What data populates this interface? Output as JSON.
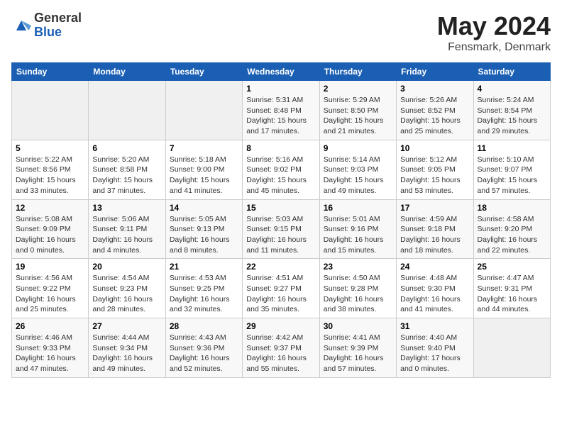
{
  "header": {
    "logo_general": "General",
    "logo_blue": "Blue",
    "month_title": "May 2024",
    "location": "Fensmark, Denmark"
  },
  "days_of_week": [
    "Sunday",
    "Monday",
    "Tuesday",
    "Wednesday",
    "Thursday",
    "Friday",
    "Saturday"
  ],
  "weeks": [
    [
      {
        "day": "",
        "content": ""
      },
      {
        "day": "",
        "content": ""
      },
      {
        "day": "",
        "content": ""
      },
      {
        "day": "1",
        "content": "Sunrise: 5:31 AM\nSunset: 8:48 PM\nDaylight: 15 hours\nand 17 minutes."
      },
      {
        "day": "2",
        "content": "Sunrise: 5:29 AM\nSunset: 8:50 PM\nDaylight: 15 hours\nand 21 minutes."
      },
      {
        "day": "3",
        "content": "Sunrise: 5:26 AM\nSunset: 8:52 PM\nDaylight: 15 hours\nand 25 minutes."
      },
      {
        "day": "4",
        "content": "Sunrise: 5:24 AM\nSunset: 8:54 PM\nDaylight: 15 hours\nand 29 minutes."
      }
    ],
    [
      {
        "day": "5",
        "content": "Sunrise: 5:22 AM\nSunset: 8:56 PM\nDaylight: 15 hours\nand 33 minutes."
      },
      {
        "day": "6",
        "content": "Sunrise: 5:20 AM\nSunset: 8:58 PM\nDaylight: 15 hours\nand 37 minutes."
      },
      {
        "day": "7",
        "content": "Sunrise: 5:18 AM\nSunset: 9:00 PM\nDaylight: 15 hours\nand 41 minutes."
      },
      {
        "day": "8",
        "content": "Sunrise: 5:16 AM\nSunset: 9:02 PM\nDaylight: 15 hours\nand 45 minutes."
      },
      {
        "day": "9",
        "content": "Sunrise: 5:14 AM\nSunset: 9:03 PM\nDaylight: 15 hours\nand 49 minutes."
      },
      {
        "day": "10",
        "content": "Sunrise: 5:12 AM\nSunset: 9:05 PM\nDaylight: 15 hours\nand 53 minutes."
      },
      {
        "day": "11",
        "content": "Sunrise: 5:10 AM\nSunset: 9:07 PM\nDaylight: 15 hours\nand 57 minutes."
      }
    ],
    [
      {
        "day": "12",
        "content": "Sunrise: 5:08 AM\nSunset: 9:09 PM\nDaylight: 16 hours\nand 0 minutes."
      },
      {
        "day": "13",
        "content": "Sunrise: 5:06 AM\nSunset: 9:11 PM\nDaylight: 16 hours\nand 4 minutes."
      },
      {
        "day": "14",
        "content": "Sunrise: 5:05 AM\nSunset: 9:13 PM\nDaylight: 16 hours\nand 8 minutes."
      },
      {
        "day": "15",
        "content": "Sunrise: 5:03 AM\nSunset: 9:15 PM\nDaylight: 16 hours\nand 11 minutes."
      },
      {
        "day": "16",
        "content": "Sunrise: 5:01 AM\nSunset: 9:16 PM\nDaylight: 16 hours\nand 15 minutes."
      },
      {
        "day": "17",
        "content": "Sunrise: 4:59 AM\nSunset: 9:18 PM\nDaylight: 16 hours\nand 18 minutes."
      },
      {
        "day": "18",
        "content": "Sunrise: 4:58 AM\nSunset: 9:20 PM\nDaylight: 16 hours\nand 22 minutes."
      }
    ],
    [
      {
        "day": "19",
        "content": "Sunrise: 4:56 AM\nSunset: 9:22 PM\nDaylight: 16 hours\nand 25 minutes."
      },
      {
        "day": "20",
        "content": "Sunrise: 4:54 AM\nSunset: 9:23 PM\nDaylight: 16 hours\nand 28 minutes."
      },
      {
        "day": "21",
        "content": "Sunrise: 4:53 AM\nSunset: 9:25 PM\nDaylight: 16 hours\nand 32 minutes."
      },
      {
        "day": "22",
        "content": "Sunrise: 4:51 AM\nSunset: 9:27 PM\nDaylight: 16 hours\nand 35 minutes."
      },
      {
        "day": "23",
        "content": "Sunrise: 4:50 AM\nSunset: 9:28 PM\nDaylight: 16 hours\nand 38 minutes."
      },
      {
        "day": "24",
        "content": "Sunrise: 4:48 AM\nSunset: 9:30 PM\nDaylight: 16 hours\nand 41 minutes."
      },
      {
        "day": "25",
        "content": "Sunrise: 4:47 AM\nSunset: 9:31 PM\nDaylight: 16 hours\nand 44 minutes."
      }
    ],
    [
      {
        "day": "26",
        "content": "Sunrise: 4:46 AM\nSunset: 9:33 PM\nDaylight: 16 hours\nand 47 minutes."
      },
      {
        "day": "27",
        "content": "Sunrise: 4:44 AM\nSunset: 9:34 PM\nDaylight: 16 hours\nand 49 minutes."
      },
      {
        "day": "28",
        "content": "Sunrise: 4:43 AM\nSunset: 9:36 PM\nDaylight: 16 hours\nand 52 minutes."
      },
      {
        "day": "29",
        "content": "Sunrise: 4:42 AM\nSunset: 9:37 PM\nDaylight: 16 hours\nand 55 minutes."
      },
      {
        "day": "30",
        "content": "Sunrise: 4:41 AM\nSunset: 9:39 PM\nDaylight: 16 hours\nand 57 minutes."
      },
      {
        "day": "31",
        "content": "Sunrise: 4:40 AM\nSunset: 9:40 PM\nDaylight: 17 hours\nand 0 minutes."
      },
      {
        "day": "",
        "content": ""
      }
    ]
  ]
}
